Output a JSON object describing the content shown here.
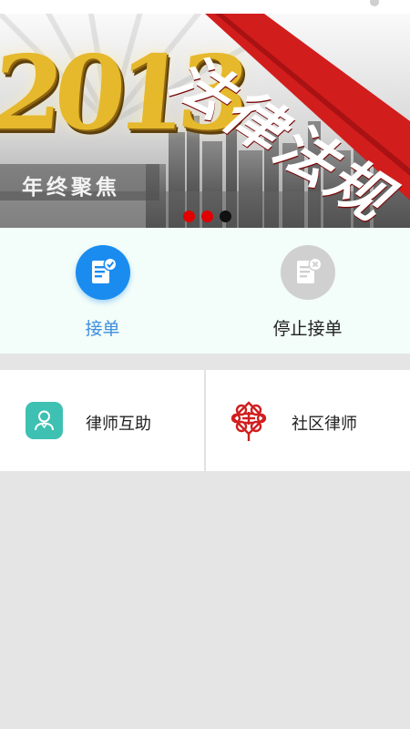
{
  "banner": {
    "year": "2013",
    "subtitle": "年终聚焦",
    "title": "法律法规",
    "dots": [
      "#e00000",
      "#e00000",
      "#111111"
    ]
  },
  "actions": [
    {
      "label": "接单",
      "icon": "clipboard-check-icon",
      "color": "#1a8cf0",
      "label_color": "#3e8fde"
    },
    {
      "label": "停止接单",
      "icon": "clipboard-cancel-icon",
      "color": "#d0d0d0",
      "label_color": "#222222"
    }
  ],
  "cards": [
    {
      "label": "律师互助",
      "icon": "lawyer-help-icon"
    },
    {
      "label": "社区律师",
      "icon": "chinese-knot-icon"
    }
  ]
}
